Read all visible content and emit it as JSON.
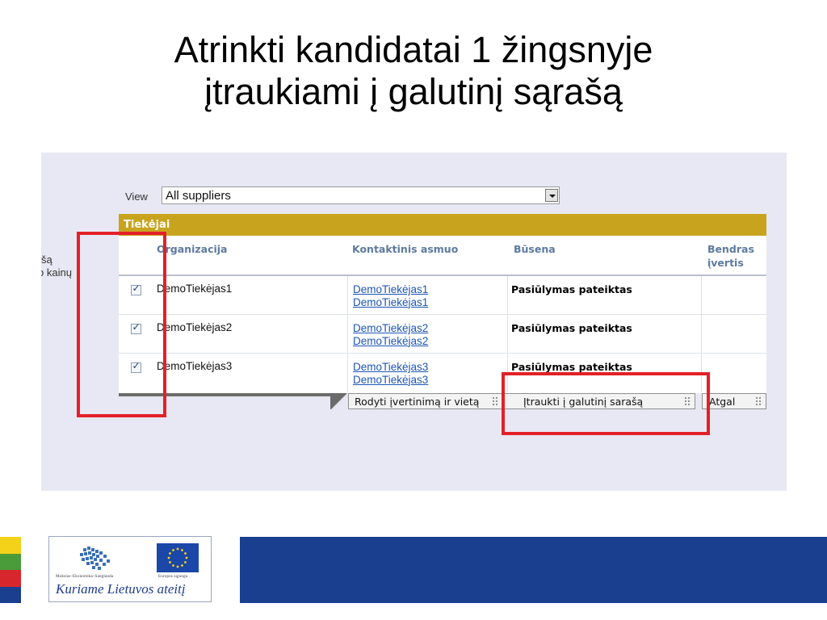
{
  "slide": {
    "title_line1": "Atrinkti kandidatai 1 žingsnyje",
    "title_line2": "įtraukiami į galutinį sąrašą"
  },
  "sidebar_cutoff": [
    "šą",
    "o kainų"
  ],
  "view": {
    "label": "View",
    "value": "All suppliers"
  },
  "grid": {
    "title": "Tiekėjai",
    "columns": {
      "organization": "Organizacija",
      "contact": "Kontaktinis asmuo",
      "status": "Būsena",
      "overall_line1": "Bendras",
      "overall_line2": "įvertis"
    },
    "rows": [
      {
        "checked": true,
        "organization": "DemoTiekėjas1",
        "contact_line1": "DemoTiekėjas1",
        "contact_line2": "DemoTiekėjas1",
        "status": "Pasiūlymas pateiktas"
      },
      {
        "checked": true,
        "organization": "DemoTiekėjas2",
        "contact_line1": "DemoTiekėjas2",
        "contact_line2": "DemoTiekėjas2",
        "status": "Pasiūlymas pateiktas"
      },
      {
        "checked": true,
        "organization": "DemoTiekėjas3",
        "contact_line1": "DemoTiekėjas3",
        "contact_line2": "DemoTiekėjas3",
        "status": "Pasiūlymas pateiktas"
      }
    ]
  },
  "toolbar": {
    "show_rating": "Rodyti įvertinimą ir vietą",
    "add_to_final": "Įtraukti į galutinį sarašą",
    "back": "Atgal"
  },
  "footer": {
    "org_caption": "Mokslas–Ekonomika–Sanglauda",
    "eu_caption": "Europos sąjunga",
    "slogan": "Kuriame Lietuvos ateitį",
    "stripe_colors": [
      "#f5d21a",
      "#4a9b3a",
      "#d8262d",
      "#1b3f8f"
    ]
  },
  "colors": {
    "grid_header": "#c8a41e",
    "highlight": "#e32028",
    "link": "#1d55b5",
    "column_header": "#5c7aa0"
  }
}
